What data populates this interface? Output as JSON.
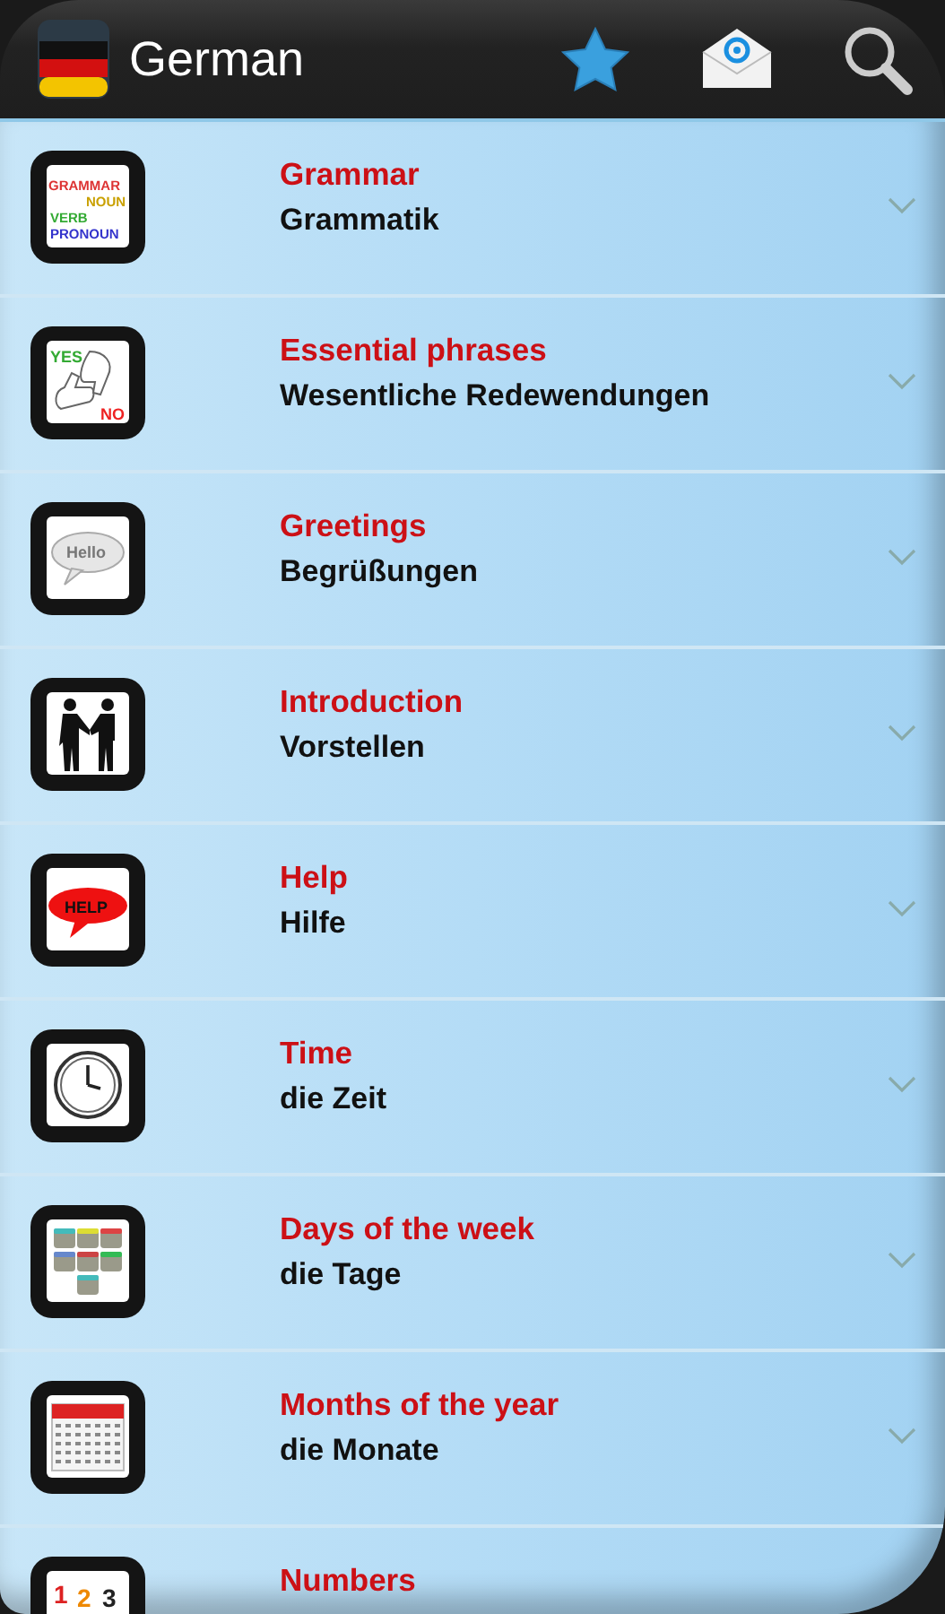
{
  "header": {
    "title": "German"
  },
  "topics": [
    {
      "title": "Grammar",
      "subtitle": "Grammatik",
      "kind": "grammar",
      "icon_words": [
        "GRAMMAR",
        "NOUN",
        "VERB",
        "PRONOUN"
      ]
    },
    {
      "title": "Essential phrases",
      "subtitle": "Wesentliche Redewendungen",
      "kind": "yesno",
      "icon_words": [
        "YES",
        "NO"
      ]
    },
    {
      "title": "Greetings",
      "subtitle": "Begrüßungen",
      "kind": "bubble",
      "icon_words": [
        "Hello"
      ]
    },
    {
      "title": "Introduction",
      "subtitle": "Vorstellen",
      "kind": "handshake"
    },
    {
      "title": "Help",
      "subtitle": "Hilfe",
      "kind": "help",
      "icon_words": [
        "HELP"
      ]
    },
    {
      "title": "Time",
      "subtitle": "die Zeit",
      "kind": "clock"
    },
    {
      "title": "Days of the week",
      "subtitle": "die Tage",
      "kind": "tiles"
    },
    {
      "title": "Months of the year",
      "subtitle": "die Monate",
      "kind": "calendar"
    },
    {
      "title": "Numbers",
      "kind": "numbers",
      "icon_words": [
        "1",
        "2",
        "3"
      ]
    }
  ]
}
